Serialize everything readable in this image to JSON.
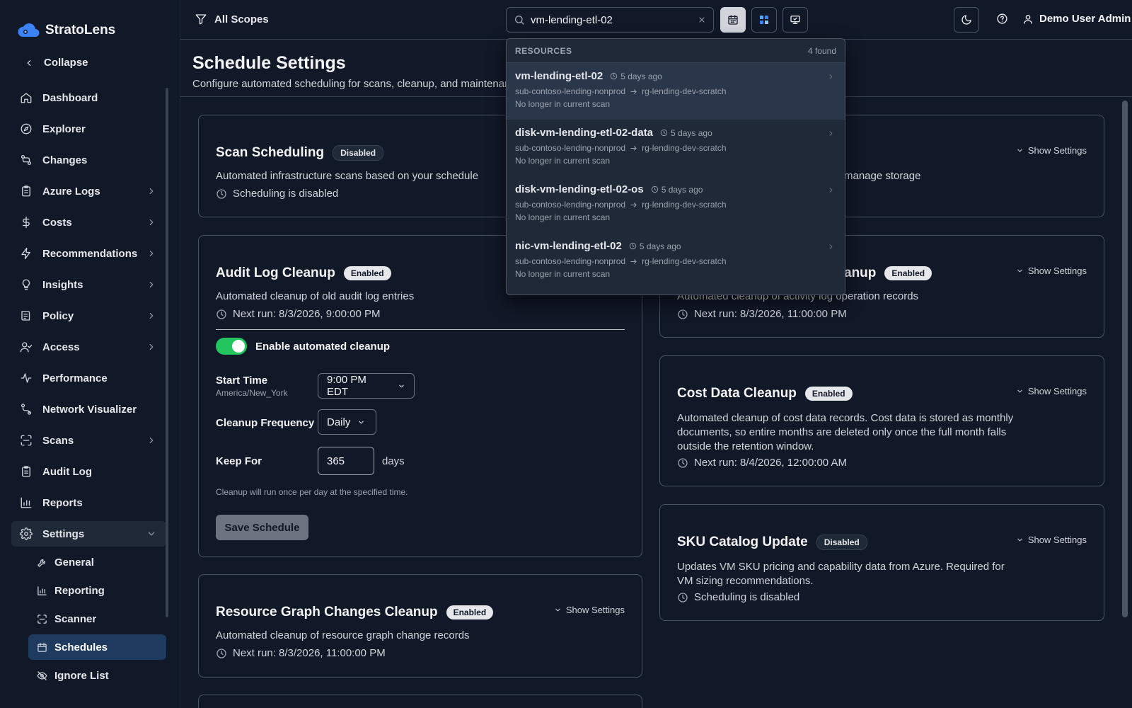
{
  "app": {
    "name": "StratoLens"
  },
  "sidebar": {
    "collapse_label": "Collapse",
    "items": [
      {
        "label": "Dashboard",
        "icon": "home-icon"
      },
      {
        "label": "Explorer",
        "icon": "compass-icon"
      },
      {
        "label": "Changes",
        "icon": "git-compare-icon"
      },
      {
        "label": "Azure Logs",
        "icon": "clipboard-icon"
      },
      {
        "label": "Costs",
        "icon": "dollar-icon"
      },
      {
        "label": "Recommendations",
        "icon": "zap-icon"
      },
      {
        "label": "Insights",
        "icon": "lightbulb-icon"
      },
      {
        "label": "Policy",
        "icon": "file-list-icon"
      },
      {
        "label": "Access",
        "icon": "user-check-icon"
      },
      {
        "label": "Performance",
        "icon": "activity-icon"
      },
      {
        "label": "Network Visualizer",
        "icon": "route-icon"
      },
      {
        "label": "Scans",
        "icon": "scan-icon"
      },
      {
        "label": "Audit Log",
        "icon": "clipboard-icon"
      },
      {
        "label": "Reports",
        "icon": "bar-chart-icon"
      },
      {
        "label": "Settings",
        "icon": "gear-icon"
      }
    ],
    "settings_sub": [
      {
        "label": "General",
        "icon": "wrench-icon"
      },
      {
        "label": "Reporting",
        "icon": "bar-chart-icon"
      },
      {
        "label": "Scanner",
        "icon": "scan-icon"
      },
      {
        "label": "Schedules",
        "icon": "calendar-icon"
      },
      {
        "label": "Ignore List",
        "icon": "eye-off-icon"
      }
    ]
  },
  "topbar": {
    "scope_label": "All Scopes",
    "search_value": "vm-lending-etl-02",
    "user_label": "Demo User Admin"
  },
  "page": {
    "title": "Schedule Settings",
    "subtitle": "Configure automated scheduling for scans, cleanup, and maintenance tasks"
  },
  "cards": {
    "scan": {
      "title": "Scan Scheduling",
      "badge": "Disabled",
      "desc": "Automated infrastructure scans based on your schedule",
      "run": "Scheduling is disabled"
    },
    "storage": {
      "desc_tail": "manage storage",
      "show_settings": "Show Settings"
    },
    "audit": {
      "title": "Audit Log Cleanup",
      "badge": "Enabled",
      "desc": "Automated cleanup of old audit log entries",
      "run": "Next run: 8/3/2026, 9:00:00 PM",
      "toggle_label": "Enable automated cleanup",
      "start_time_label": "Start Time",
      "timezone": "America/New_York",
      "start_time_value": "9:00 PM EDT",
      "frequency_label": "Cleanup Frequency",
      "frequency_value": "Daily",
      "keep_label": "Keep For",
      "keep_value": "365",
      "keep_unit": "days",
      "hint": "Cleanup will run once per day at the specified time.",
      "save_label": "Save Schedule"
    },
    "activity": {
      "title_tail": "anup",
      "badge": "Enabled",
      "desc": "Automated cleanup of activity log operation records",
      "run": "Next run: 8/3/2026, 11:00:00 PM",
      "show_settings": "Show Settings"
    },
    "cost": {
      "title": "Cost Data Cleanup",
      "badge": "Enabled",
      "desc": "Automated cleanup of cost data records. Cost data is stored as monthly documents, so entire months are deleted only once the full month falls outside the retention window.",
      "run": "Next run: 8/4/2026, 12:00:00 AM",
      "show_settings": "Show Settings"
    },
    "sku": {
      "title": "SKU Catalog Update",
      "badge": "Disabled",
      "desc": "Updates VM SKU pricing and capability data from Azure. Required for VM sizing recommendations.",
      "run": "Scheduling is disabled",
      "show_settings": "Show Settings"
    },
    "rg": {
      "title": "Resource Graph Changes Cleanup",
      "badge": "Enabled",
      "desc": "Automated cleanup of resource graph change records",
      "run": "Next run: 8/3/2026, 11:00:00 PM",
      "show_settings": "Show Settings"
    }
  },
  "dropdown": {
    "category": "RESOURCES",
    "count": "4 found",
    "results": [
      {
        "name": "vm-lending-etl-02",
        "age": "5 days ago",
        "subscription": "sub-contoso-lending-nonprod",
        "resource_group": "rg-lending-dev-scratch",
        "status": "No longer in current scan"
      },
      {
        "name": "disk-vm-lending-etl-02-data",
        "age": "5 days ago",
        "subscription": "sub-contoso-lending-nonprod",
        "resource_group": "rg-lending-dev-scratch",
        "status": "No longer in current scan"
      },
      {
        "name": "disk-vm-lending-etl-02-os",
        "age": "5 days ago",
        "subscription": "sub-contoso-lending-nonprod",
        "resource_group": "rg-lending-dev-scratch",
        "status": "No longer in current scan"
      },
      {
        "name": "nic-vm-lending-etl-02",
        "age": "5 days ago",
        "subscription": "sub-contoso-lending-nonprod",
        "resource_group": "rg-lending-dev-scratch",
        "status": "No longer in current scan"
      }
    ]
  },
  "colors": {
    "background": "#111827",
    "toggle_on": "#22c55e",
    "active_nav": "#1e3a5f"
  }
}
